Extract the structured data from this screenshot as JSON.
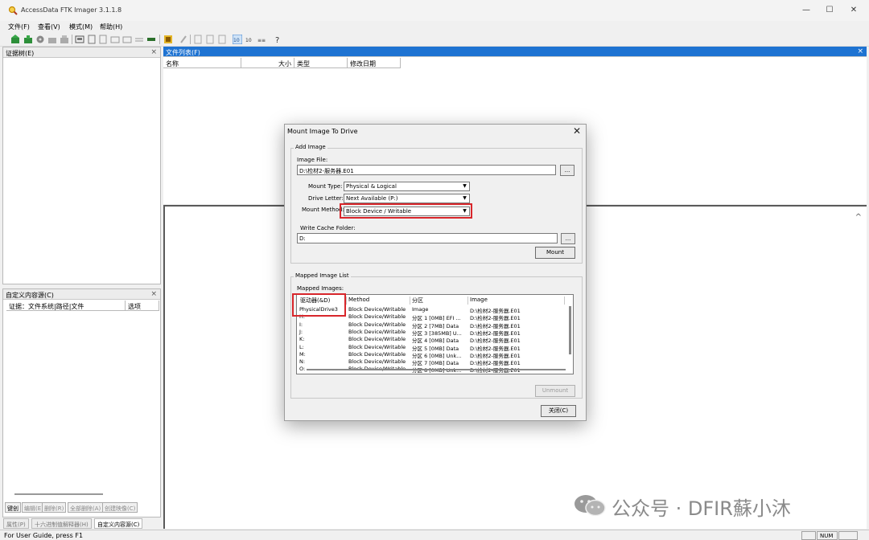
{
  "window": {
    "title": "AccessData FTK Imager 3.1.1.8",
    "minimize": "—",
    "maximize": "☐",
    "close": "✕"
  },
  "menu": [
    "文件(F)",
    "查看(V)",
    "模式(M)",
    "帮助(H)"
  ],
  "evidence_panel": {
    "title": "证据树(E)",
    "close": "×"
  },
  "file_list_panel": {
    "title": "文件列表(F)",
    "close": "×",
    "columns": [
      "名称",
      "大小",
      "类型",
      "修改日期"
    ]
  },
  "custom_content_panel": {
    "title": "自定义内容源(C)",
    "close": "×",
    "columns": [
      "证据：文件系统|路径|文件",
      "选项"
    ]
  },
  "bottom_buttons": [
    "键创",
    "编辑(E)",
    "删除(R)",
    "全部删除(A)",
    "创建映像(C)"
  ],
  "bottom_tabs": [
    "属性(P)",
    "十六进制值解释器(H)",
    "自定义内容源(C)"
  ],
  "status": {
    "text": "For User Guide, press F1",
    "num": "NUM"
  },
  "lower_pane": {
    "chevron": "^"
  },
  "watermark": {
    "text": "公众号 · DFIR蘇小沐"
  },
  "dialog": {
    "title": "Mount Image To Drive",
    "close": "✕",
    "add_image_group": "Add Image",
    "image_file_label": "Image File:",
    "image_file_value": "D:\\检材2-服务器.E01",
    "browse": "...",
    "mount_type_label": "Mount Type:",
    "mount_type_value": "Physical & Logical",
    "drive_letter_label": "Drive Letter:",
    "drive_letter_value": "Next Available (P:)",
    "mount_method_label": "Mount Method:",
    "mount_method_value": "Block Device / Writable",
    "write_cache_label": "Write Cache Folder:",
    "write_cache_value": "D:",
    "mount_button": "Mount",
    "mapped_group": "Mapped Image List",
    "mapped_images_label": "Mapped Images:",
    "list_columns": [
      "驱动器(&D)",
      "Method",
      "分区",
      "Image"
    ],
    "list_rows": [
      {
        "drive": "PhysicalDrive3",
        "method": "Block Device/Writable",
        "partition": "Image",
        "image": "D:\\检材2-服务器.E01"
      },
      {
        "drive": "H:",
        "method": "Block Device/Writable",
        "partition": "分区 1 [0MB] EFI ...",
        "image": "D:\\检材2-服务器.E01"
      },
      {
        "drive": "I:",
        "method": "Block Device/Writable",
        "partition": "分区 2 [7MB] Data",
        "image": "D:\\检材2-服务器.E01"
      },
      {
        "drive": "J:",
        "method": "Block Device/Writable",
        "partition": "分区 3 [385MB] U...",
        "image": "D:\\检材2-服务器.E01"
      },
      {
        "drive": "K:",
        "method": "Block Device/Writable",
        "partition": "分区 4 [0MB] Data",
        "image": "D:\\检材2-服务器.E01"
      },
      {
        "drive": "L:",
        "method": "Block Device/Writable",
        "partition": "分区 5 [0MB] Data",
        "image": "D:\\检材2-服务器.E01"
      },
      {
        "drive": "M:",
        "method": "Block Device/Writable",
        "partition": "分区 6 [0MB] Unk...",
        "image": "D:\\检材2-服务器.E01"
      },
      {
        "drive": "N:",
        "method": "Block Device/Writable",
        "partition": "分区 7 [0MB] Data",
        "image": "D:\\检材2-服务器.E01"
      },
      {
        "drive": "O:",
        "method": "Block Device/Writable",
        "partition": "分区 8 [0MB] Unk...",
        "image": "D:\\检材2-服务器.E01"
      }
    ],
    "unmount_button": "Unmount",
    "close_button": "关闭(C)"
  },
  "colors": {
    "accent": "#1e73d2",
    "highlight": "#d8262b"
  }
}
